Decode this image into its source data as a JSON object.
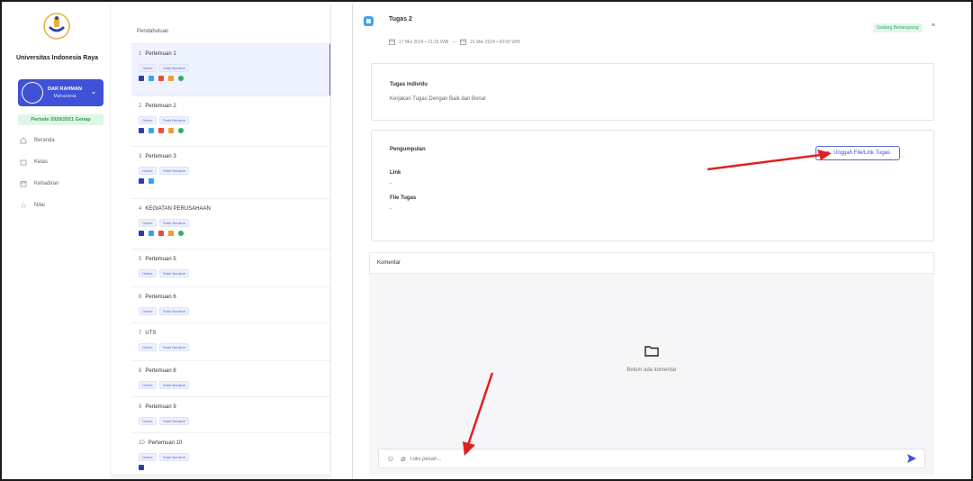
{
  "sidebar": {
    "university": "Universitas Indonesia Raya",
    "user_name": "DAR RAHMAN",
    "user_role": "Mahasiswa",
    "period": "Periode 2020/2021 Genap",
    "nav": [
      {
        "label": "Beranda",
        "icon": "home-icon"
      },
      {
        "label": "Kelas",
        "icon": "folder-icon"
      },
      {
        "label": "Kehadiran",
        "icon": "calendar-icon"
      },
      {
        "label": "Nilai",
        "icon": "star-icon"
      }
    ]
  },
  "meetings": {
    "header": "Pendahuluan",
    "badge_online": "Online",
    "badge_done": "Telah Berakhir",
    "items": [
      {
        "num": "1",
        "title": "Pertemuan 1"
      },
      {
        "num": "2",
        "title": "Pertemuan 2"
      },
      {
        "num": "3",
        "title": "Pertemuan 3"
      },
      {
        "num": "4",
        "title": "KEGIATAN PERUSAHAAN"
      },
      {
        "num": "5",
        "title": "Pertemuan 5"
      },
      {
        "num": "6",
        "title": "Pertemuan 6"
      },
      {
        "num": "7",
        "title": "UTS"
      },
      {
        "num": "8",
        "title": "Pertemuan 8"
      },
      {
        "num": "9",
        "title": "Pertemuan 9"
      },
      {
        "num": "10",
        "title": "Pertemuan 10"
      }
    ]
  },
  "task": {
    "title": "Tugas 2",
    "start": "17 Mei 2024 • 21:15 WIB",
    "separator": "—",
    "end": "21 Mei 2024 • 00:00 WIB",
    "status": "Sedang Berlangsung",
    "card1_label": "Tugas individu",
    "card1_text": "Kerjakan Tugas Dengan Baik dan Benar",
    "card2_label": "Pengumpulan",
    "upload_label": "Unggah File/Link Tugas",
    "link_label": "Link",
    "link_value": "-",
    "file_label": "File Tugas",
    "file_value": "-"
  },
  "comments": {
    "header": "Komentar",
    "empty": "Belum ada komentar",
    "placeholder": "Tulis pesan..."
  },
  "colors": {
    "accent": "#3f51d6",
    "status_green": "#2fae60",
    "arrow_red": "#e02020"
  }
}
